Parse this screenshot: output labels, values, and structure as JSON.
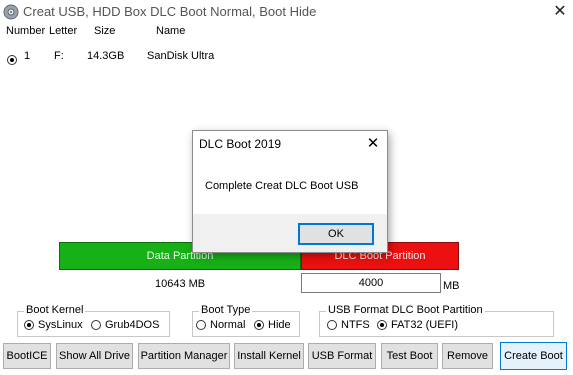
{
  "window": {
    "title": "Creat USB, HDD Box DLC Boot Normal, Boot Hide",
    "close_glyph": "✕",
    "icon": "gear-disc-icon"
  },
  "drive_table": {
    "headers": [
      "Number",
      "Letter",
      "Size",
      "Name"
    ],
    "rows": [
      {
        "selected": true,
        "number": "1",
        "letter": "F:",
        "size": "14.3GB",
        "name": "SanDisk Ultra"
      }
    ]
  },
  "partition_bar": {
    "data_label": "Data Partition",
    "boot_label": "DLC Boot Partition",
    "data_color": "#17b117",
    "boot_color": "#ec1010",
    "data_size_text": "10643 MB",
    "boot_size_value": "4000",
    "boot_size_unit": "MB"
  },
  "boot_kernel": {
    "label": "Boot Kernel",
    "options": [
      {
        "label": "SysLinux",
        "selected": true
      },
      {
        "label": "Grub4DOS",
        "selected": false
      }
    ]
  },
  "boot_type": {
    "label": "Boot Type",
    "options": [
      {
        "label": "Normal",
        "selected": false
      },
      {
        "label": "Hide",
        "selected": true
      }
    ]
  },
  "usb_format": {
    "label": "USB Format DLC Boot Partition",
    "options": [
      {
        "label": "NTFS",
        "selected": false
      },
      {
        "label": "FAT32 (UEFI)",
        "selected": true
      }
    ]
  },
  "buttons": {
    "bootice": "BootICE",
    "show_all_drive": "Show All Drive",
    "partition_manager": "Partition Manager",
    "install_kernel": "Install Kernel",
    "usb_format": "USB Format",
    "test_boot": "Test Boot",
    "remove": "Remove",
    "create_boot": "Create Boot"
  },
  "dialog": {
    "title": "DLC Boot 2019",
    "close_glyph": "✕",
    "message": "Complete Creat DLC Boot USB",
    "ok_label": "OK"
  }
}
